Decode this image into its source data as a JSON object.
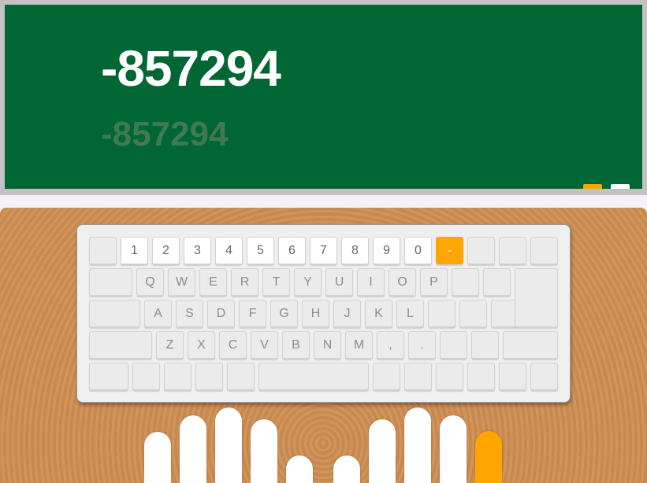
{
  "board": {
    "target": "-857294",
    "typed": "-857294",
    "indicators": [
      {
        "name": "board-indicator-orange",
        "color": "#ffa500"
      },
      {
        "name": "board-indicator-white",
        "color": "#ffffff"
      }
    ]
  },
  "colors": {
    "board": "#006633",
    "highlight": "#ffa500",
    "desk": "#d08f52"
  },
  "keyboard": {
    "active_key": "-",
    "row1": [
      "",
      "1",
      "2",
      "3",
      "4",
      "5",
      "6",
      "7",
      "8",
      "9",
      "0",
      "-",
      "",
      "",
      ""
    ],
    "row2": [
      "",
      "Q",
      "W",
      "E",
      "R",
      "T",
      "Y",
      "U",
      "I",
      "O",
      "P",
      "",
      "",
      ""
    ],
    "row3": [
      "",
      "A",
      "S",
      "D",
      "F",
      "G",
      "H",
      "J",
      "K",
      "L",
      "",
      "",
      ""
    ],
    "row4": [
      "",
      "Z",
      "X",
      "C",
      "V",
      "B",
      "N",
      "M",
      ",",
      ".",
      "",
      "",
      ""
    ],
    "row5": [
      "",
      "",
      "",
      "",
      "",
      "",
      "",
      "",
      "",
      "",
      "",
      ""
    ]
  },
  "hands": {
    "active_finger": "right-pinky"
  }
}
